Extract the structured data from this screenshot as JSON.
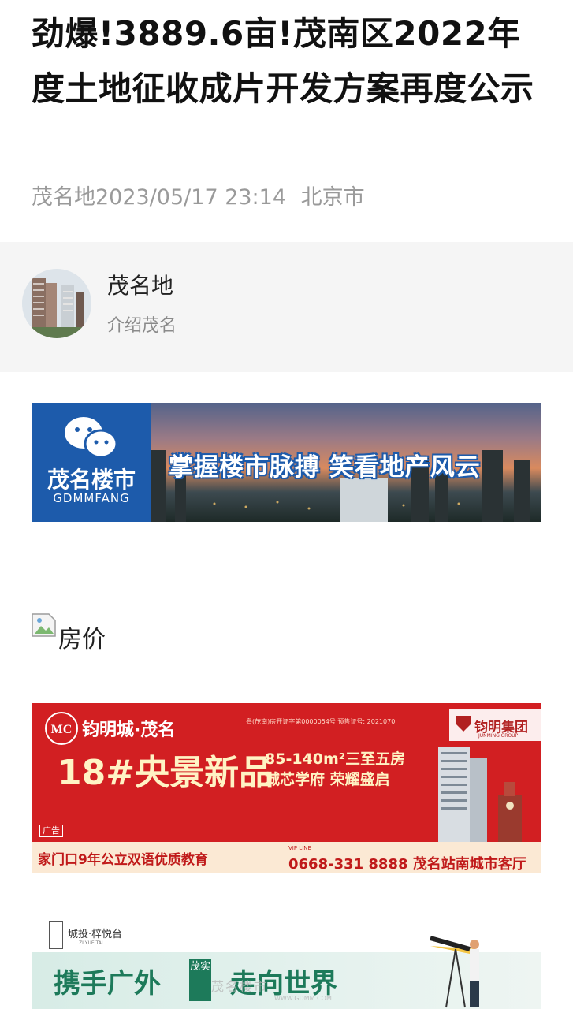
{
  "article": {
    "title": "劲爆!3889.6亩!茂南区2022年度土地征收成片开发方案再度公示",
    "author": "茂名地",
    "datetime": "2023/05/17 23:14",
    "location": "北京市"
  },
  "account": {
    "name": "茂名地",
    "description": "介绍茂名"
  },
  "banner_top": {
    "brand": "茂名楼市",
    "brand_en": "GDMMFANG",
    "slogan": "掌握楼市脉搏 笑看地产风云"
  },
  "broken_image": {
    "alt": "房价"
  },
  "ad_banner": {
    "logo_text": "钧明城·茂名",
    "permit": "粤(茂南)房开证字第0000054号  预售证号: 2021070",
    "group": "钧明集团",
    "group_en": "JUNMING GROUP",
    "headline": "18#央景新品",
    "spec1": "85-140m²三至五房",
    "spec2": "城芯学府 荣耀盛启",
    "ad_label": "广告",
    "education": "家门口9年公立双语优质教育",
    "vip_line": "VIP LINE",
    "phone": "0668-331 8888 茂名站南城市客厅"
  },
  "banner_bottom": {
    "brand": "城投·梓悦台",
    "brand_en": "ZI YUE TAI",
    "slogan_part1": "携手广外",
    "tag": "茂实",
    "slogan_part2": "走向世界"
  },
  "watermark": {
    "text": "茂名楼市",
    "url": "WWW.GDMM.COM"
  },
  "colors": {
    "meta_gray": "#9a9a9a",
    "card_bg": "#f5f5f5",
    "brand_blue": "#1d5bab",
    "ad_red": "#d21f22",
    "green": "#1d7a5a"
  }
}
